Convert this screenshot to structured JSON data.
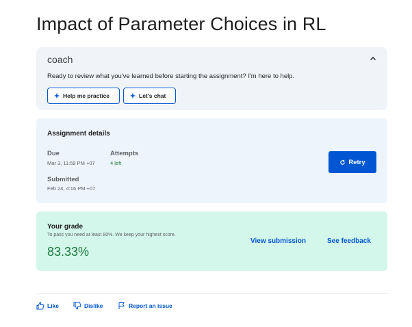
{
  "page": {
    "title": "Impact of Parameter Choices in RL"
  },
  "coach": {
    "name": "coach",
    "message": "Ready to review what you've learned before starting the assignment? I'm here to help.",
    "practice_label": "Help me practice",
    "chat_label": "Let's chat"
  },
  "assignment": {
    "heading": "Assignment details",
    "due_label": "Due",
    "due_value": "Mar 3, 11:59 PM +07",
    "attempts_label": "Attempts",
    "attempts_value": "4 left",
    "submitted_label": "Submitted",
    "submitted_value": "Feb 24, 4:16 PM +07",
    "retry_label": "Retry"
  },
  "grade": {
    "heading": "Your grade",
    "note": "To pass you need at least 80%. We keep your highest score.",
    "value": "83.33%",
    "view_submission": "View submission",
    "see_feedback": "See feedback"
  },
  "footer": {
    "like": "Like",
    "dislike": "Dislike",
    "report": "Report an issue"
  },
  "colors": {
    "accent": "#0056d2",
    "success": "#1a7a3c",
    "grade_bg": "#d4f7eb",
    "details_bg": "#eef4fc"
  }
}
